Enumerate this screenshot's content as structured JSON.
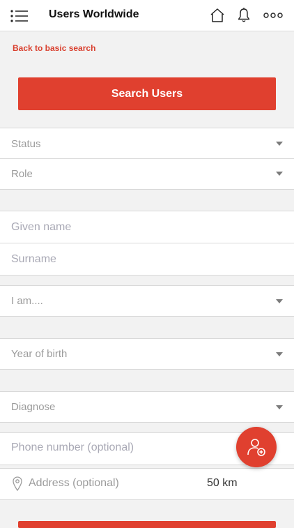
{
  "header": {
    "title": "Users Worldwide",
    "icons": [
      "menu-icon",
      "home-icon",
      "bell-icon",
      "more-icon"
    ]
  },
  "search": {
    "back_link": "Back to basic search",
    "search_button": "Search Users"
  },
  "filters": {
    "status": "Status",
    "role": "Role",
    "given_name": "Given name",
    "surname": "Surname",
    "i_am": "I am....",
    "year_of_birth": "Year of birth",
    "diagnose": "Diagnose",
    "phone": "Phone number (optional)",
    "address": "Address (optional)",
    "distance": "50 km"
  },
  "colors": {
    "accent": "#e0402f",
    "link": "#d9402f",
    "placeholder": "#9b9b9b"
  }
}
